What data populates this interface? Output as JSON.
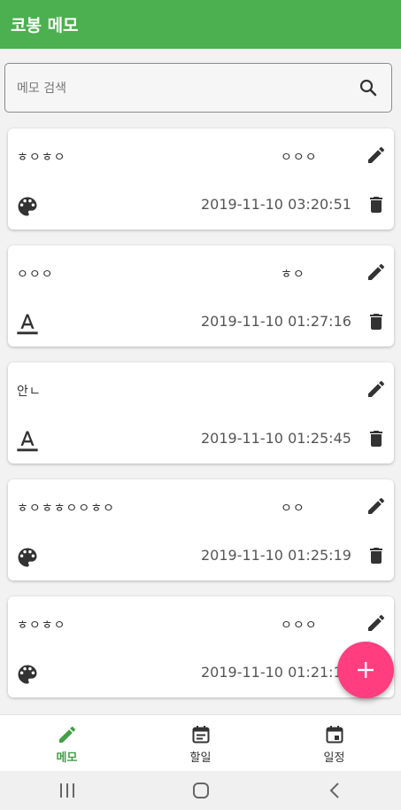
{
  "appbar": {
    "title": "코봉 메모"
  },
  "search": {
    "placeholder": "메모 검색",
    "icon": "search-icon"
  },
  "memos": [
    {
      "title": "ㅎㅇㅎㅇ",
      "subtitle": "ㅇㅇㅇ",
      "date": "2019-11-10 03:20:51",
      "color_icon": "palette-icon"
    },
    {
      "title": "ㅇㅇㅇ",
      "subtitle": "ㅎㅇ",
      "date": "2019-11-10 01:27:16",
      "color_icon": "text-color-icon"
    },
    {
      "title": "안ㄴ",
      "subtitle": "",
      "date": "2019-11-10 01:25:45",
      "color_icon": "text-color-icon"
    },
    {
      "title": "ㅎㅇㅎㅎㅇㅇㅎㅇ",
      "subtitle": "ㅇㅇ",
      "date": "2019-11-10 01:25:19",
      "color_icon": "palette-icon"
    },
    {
      "title": "ㅎㅇㅎㅇ",
      "subtitle": "ㅇㅇㅇ",
      "date": "2019-11-10 01:21:10",
      "color_icon": "palette-icon"
    }
  ],
  "nav": {
    "items": [
      {
        "label": "메모",
        "icon": "pencil-icon",
        "active": true
      },
      {
        "label": "할일",
        "icon": "event-note-icon",
        "active": false
      },
      {
        "label": "일정",
        "icon": "calendar-icon",
        "active": false
      }
    ]
  },
  "colors": {
    "appbar": "#4caf50",
    "fab": "#ff3d7f",
    "active_nav": "#43a047"
  }
}
